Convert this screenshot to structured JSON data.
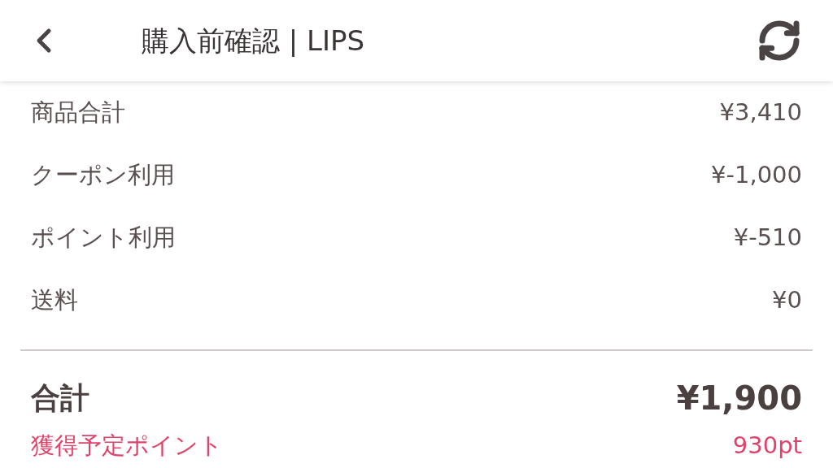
{
  "header": {
    "title": "購入前確認 | LIPS"
  },
  "lines": [
    {
      "label": "商品合計",
      "amount": "¥3,410"
    },
    {
      "label": "クーポン利用",
      "amount": "¥-1,000"
    },
    {
      "label": "ポイント利用",
      "amount": "¥-510"
    },
    {
      "label": "送料",
      "amount": "¥0"
    }
  ],
  "total": {
    "label": "合計",
    "amount": "¥1,900"
  },
  "points": {
    "label": "獲得予定ポイント",
    "amount": "930pt"
  }
}
